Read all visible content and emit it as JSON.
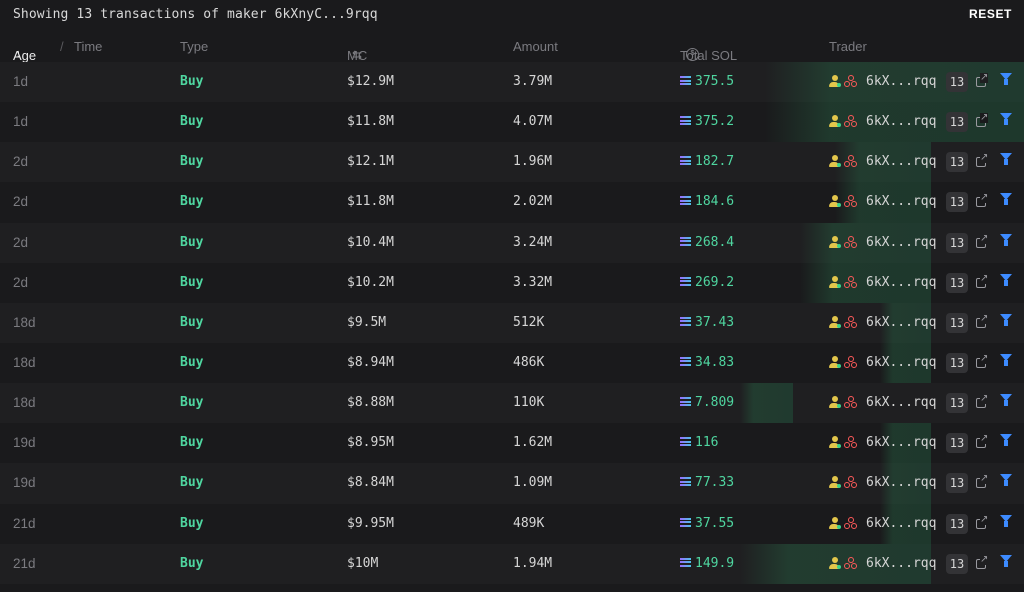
{
  "header": {
    "summary": "Showing 13 transactions of maker 6kXnyC...9rqq",
    "reset_label": "RESET"
  },
  "columns": {
    "age": "Age",
    "age_sort_icon": "arrow-down-icon",
    "separator": "/",
    "time": "Time",
    "type": "Type",
    "mc": "MC",
    "mc_icon": "swap-icon",
    "amount": "Amount",
    "total_sol": "Total SOL",
    "total_sol_icon": "currency-toggle-icon",
    "trader": "Trader"
  },
  "colors": {
    "buy": "#4fd6a0",
    "background": "#1a1a1c",
    "row_alt": "#1f1f21",
    "filter": "#3d8bff",
    "bundle": "#ff5a5a",
    "holder": "#e3c64b"
  },
  "rows": [
    {
      "age": "1d",
      "type": "Buy",
      "mc": "$12.9M",
      "amount": "3.79M",
      "total_sol": "375.5",
      "trader": "6kX...rqq",
      "count": "13"
    },
    {
      "age": "1d",
      "type": "Buy",
      "mc": "$11.8M",
      "amount": "4.07M",
      "total_sol": "375.2",
      "trader": "6kX...rqq",
      "count": "13"
    },
    {
      "age": "2d",
      "type": "Buy",
      "mc": "$12.1M",
      "amount": "1.96M",
      "total_sol": "182.7",
      "trader": "6kX...rqq",
      "count": "13"
    },
    {
      "age": "2d",
      "type": "Buy",
      "mc": "$11.8M",
      "amount": "2.02M",
      "total_sol": "184.6",
      "trader": "6kX...rqq",
      "count": "13"
    },
    {
      "age": "2d",
      "type": "Buy",
      "mc": "$10.4M",
      "amount": "3.24M",
      "total_sol": "268.4",
      "trader": "6kX...rqq",
      "count": "13"
    },
    {
      "age": "2d",
      "type": "Buy",
      "mc": "$10.2M",
      "amount": "3.32M",
      "total_sol": "269.2",
      "trader": "6kX...rqq",
      "count": "13"
    },
    {
      "age": "18d",
      "type": "Buy",
      "mc": "$9.5M",
      "amount": "512K",
      "total_sol": "37.43",
      "trader": "6kX...rqq",
      "count": "13"
    },
    {
      "age": "18d",
      "type": "Buy",
      "mc": "$8.94M",
      "amount": "486K",
      "total_sol": "34.83",
      "trader": "6kX...rqq",
      "count": "13"
    },
    {
      "age": "18d",
      "type": "Buy",
      "mc": "$8.88M",
      "amount": "110K",
      "total_sol": "7.809",
      "trader": "6kX...rqq",
      "count": "13"
    },
    {
      "age": "19d",
      "type": "Buy",
      "mc": "$8.95M",
      "amount": "1.62M",
      "total_sol": "116",
      "trader": "6kX...rqq",
      "count": "13"
    },
    {
      "age": "19d",
      "type": "Buy",
      "mc": "$8.84M",
      "amount": "1.09M",
      "total_sol": "77.33",
      "trader": "6kX...rqq",
      "count": "13"
    },
    {
      "age": "21d",
      "type": "Buy",
      "mc": "$9.95M",
      "amount": "489K",
      "total_sol": "37.55",
      "trader": "6kX...rqq",
      "count": "13"
    },
    {
      "age": "21d",
      "type": "Buy",
      "mc": "$10M",
      "amount": "1.94M",
      "total_sol": "149.9",
      "trader": "6kX...rqq",
      "count": "13"
    }
  ]
}
